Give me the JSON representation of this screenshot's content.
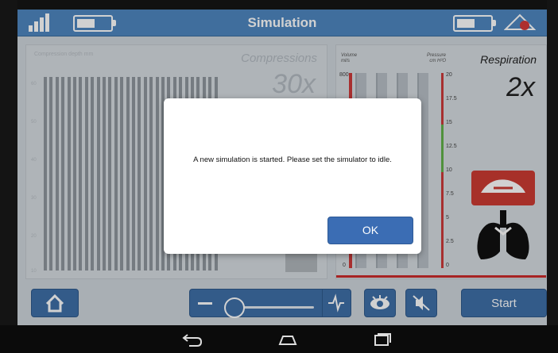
{
  "header": {
    "title": "Simulation"
  },
  "compressions": {
    "label": "Compressions",
    "count": "30x",
    "small_label": "Compression depth mm",
    "axis": [
      "60",
      "50",
      "40",
      "30",
      "20",
      "10"
    ]
  },
  "respiration": {
    "label": "Respiration",
    "count": "2x",
    "volume_label": "Volume\nml/s",
    "pressure_label": "Pressure\ncm H²O",
    "volume_ticks": [
      "800",
      "0"
    ],
    "pressure_ticks": [
      "20",
      "17.5",
      "15",
      "12.5",
      "10",
      "7.5",
      "5",
      "2.5",
      "0"
    ]
  },
  "dialog": {
    "message": "A new simulation is started. Please set the simulator to idle.",
    "ok_label": "OK"
  },
  "toolbar": {
    "start_label": "Start",
    "slider_level": 0.05
  },
  "colors": {
    "header": "#4f87c0",
    "button": "#3f6fa8",
    "alert_red": "#cc2b2b",
    "gauge_green": "#62b14a"
  },
  "icons": [
    "signal-icon",
    "battery-icon",
    "logo-icon",
    "home-icon",
    "heartbeat-icon",
    "eye-icon",
    "mute-icon",
    "face-icon",
    "lungs-icon",
    "back-icon",
    "home-nav-icon",
    "recents-icon"
  ]
}
